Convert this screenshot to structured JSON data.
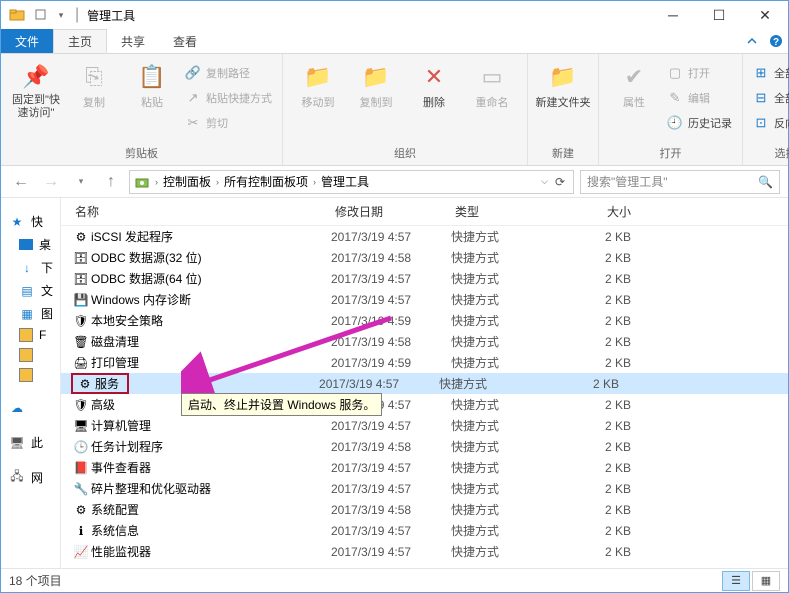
{
  "title": "管理工具",
  "tabs": {
    "file": "文件",
    "home": "主页",
    "share": "共享",
    "view": "查看"
  },
  "ribbon": {
    "pin": "固定到\"快速访问\"",
    "copy": "复制",
    "paste": "粘贴",
    "copy_path": "复制路径",
    "paste_shortcut": "粘贴快捷方式",
    "cut": "剪切",
    "clipboard_label": "剪贴板",
    "move_to": "移动到",
    "copy_to": "复制到",
    "delete": "删除",
    "rename": "重命名",
    "organize_label": "组织",
    "new_folder": "新建文件夹",
    "new_label": "新建",
    "properties": "属性",
    "open": "打开",
    "edit": "编辑",
    "history": "历史记录",
    "open_label": "打开",
    "select_all": "全部选择",
    "select_none": "全部取消",
    "invert": "反向选择",
    "select_label": "选择"
  },
  "breadcrumbs": [
    "控制面板",
    "所有控制面板项",
    "管理工具"
  ],
  "search_placeholder": "搜索\"管理工具\"",
  "columns": {
    "name": "名称",
    "date": "修改日期",
    "type": "类型",
    "size": "大小"
  },
  "sidebar": {
    "quick": "快",
    "items1": [
      "桌",
      "下",
      "文",
      "图"
    ],
    "items2": [
      "F",
      "",
      ""
    ],
    "onedrive": "",
    "thispc": "此",
    "network": "网"
  },
  "files": [
    {
      "name": "iSCSI 发起程序",
      "date": "2017/3/19 4:57",
      "type": "快捷方式",
      "size": "2 KB",
      "icon": "app"
    },
    {
      "name": "ODBC 数据源(32 位)",
      "date": "2017/3/19 4:58",
      "type": "快捷方式",
      "size": "2 KB",
      "icon": "db"
    },
    {
      "name": "ODBC 数据源(64 位)",
      "date": "2017/3/19 4:57",
      "type": "快捷方式",
      "size": "2 KB",
      "icon": "db"
    },
    {
      "name": "Windows 内存诊断",
      "date": "2017/3/19 4:57",
      "type": "快捷方式",
      "size": "2 KB",
      "icon": "mem"
    },
    {
      "name": "本地安全策略",
      "date": "2017/3/19 4:59",
      "type": "快捷方式",
      "size": "2 KB",
      "icon": "shield"
    },
    {
      "name": "磁盘清理",
      "date": "2017/3/19 4:58",
      "type": "快捷方式",
      "size": "2 KB",
      "icon": "disk"
    },
    {
      "name": "打印管理",
      "date": "2017/3/19 4:59",
      "type": "快捷方式",
      "size": "2 KB",
      "icon": "print"
    },
    {
      "name": "服务",
      "date": "2017/3/19 4:57",
      "type": "快捷方式",
      "size": "2 KB",
      "icon": "gear",
      "selected": true,
      "boxed": true
    },
    {
      "name": "高级 启动、终止并设置 Windows 服务。",
      "date": "2017/3/19 4:57",
      "type": "快捷方式",
      "size": "2 KB",
      "icon": "shield",
      "truncated_name": "高级"
    },
    {
      "name": "计算机管理",
      "date": "2017/3/19 4:57",
      "type": "快捷方式",
      "size": "2 KB",
      "icon": "pc"
    },
    {
      "name": "任务计划程序",
      "date": "2017/3/19 4:58",
      "type": "快捷方式",
      "size": "2 KB",
      "icon": "clock"
    },
    {
      "name": "事件查看器",
      "date": "2017/3/19 4:57",
      "type": "快捷方式",
      "size": "2 KB",
      "icon": "book"
    },
    {
      "name": "碎片整理和优化驱动器",
      "date": "2017/3/19 4:57",
      "type": "快捷方式",
      "size": "2 KB",
      "icon": "defrag"
    },
    {
      "name": "系统配置",
      "date": "2017/3/19 4:58",
      "type": "快捷方式",
      "size": "2 KB",
      "icon": "cfg"
    },
    {
      "name": "系统信息",
      "date": "2017/3/19 4:57",
      "type": "快捷方式",
      "size": "2 KB",
      "icon": "info"
    },
    {
      "name": "性能监视器",
      "date": "2017/3/19 4:57",
      "type": "快捷方式",
      "size": "2 KB",
      "icon": "perf"
    }
  ],
  "tooltip": "启动、终止并设置 Windows 服务。",
  "status": "18 个项目"
}
